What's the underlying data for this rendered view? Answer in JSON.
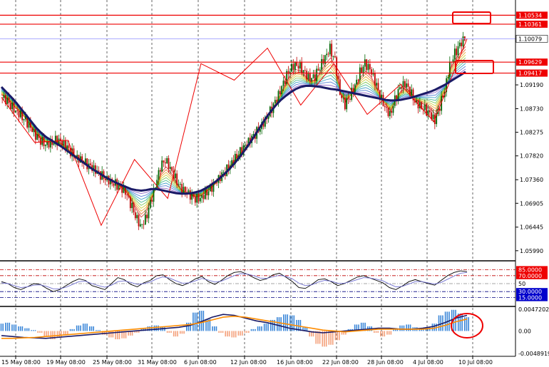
{
  "chart_data": [
    {
      "type": "candlestick",
      "title": "",
      "y_axis_ticks": [
        "1.09190",
        "1.08730",
        "1.08275",
        "1.07820",
        "1.07360",
        "1.06905",
        "1.06445",
        "1.05990"
      ],
      "x_axis_ticks": [
        "15 May 08:00",
        "19 May 08:00",
        "25 May 08:00",
        "31 May 08:00",
        "6 Jun 08:00",
        "12 Jun 08:00",
        "16 Jun 08:00",
        "22 Jun 08:00",
        "28 Jun 08:00",
        "4 Jul 08:00",
        "10 Jul 08:00"
      ],
      "ylim": [
        1.0585,
        1.108
      ],
      "horizontal_levels": [
        {
          "value": 1.10534,
          "label": "1.10534",
          "color": "#ee0000"
        },
        {
          "value": 1.10361,
          "label": "1.10361",
          "color": "#ee0000"
        },
        {
          "value": 1.09629,
          "label": "1.09629",
          "color": "#ee0000"
        },
        {
          "value": 1.09417,
          "label": "1.09417",
          "color": "#ee0000"
        }
      ],
      "current_price": {
        "value": 1.10079,
        "label": "1.10079"
      },
      "price_path": [
        1.0895,
        1.089,
        1.088,
        1.087,
        1.0862,
        1.085,
        1.0835,
        1.082,
        1.0812,
        1.0805,
        1.0808,
        1.0812,
        1.0808,
        1.08,
        1.079,
        1.0782,
        1.0776,
        1.0768,
        1.076,
        1.0752,
        1.0745,
        1.074,
        1.0734,
        1.0728,
        1.072,
        1.071,
        1.069,
        1.0668,
        1.0648,
        1.066,
        1.069,
        1.0722,
        1.076,
        1.0775,
        1.076,
        1.074,
        1.072,
        1.0712,
        1.0705,
        1.07,
        1.0702,
        1.071,
        1.0718,
        1.0728,
        1.074,
        1.0752,
        1.0766,
        1.078,
        1.079,
        1.08,
        1.0812,
        1.0824,
        1.0838,
        1.0852,
        1.0868,
        1.0885,
        1.0905,
        1.093,
        1.095,
        1.096,
        1.0955,
        1.094,
        1.0928,
        1.0935,
        1.0955,
        1.0975,
        1.099,
        1.0965,
        1.09,
        1.088,
        1.0898,
        1.092,
        1.0945,
        1.096,
        1.0948,
        1.0925,
        1.0898,
        1.0878,
        1.0862,
        1.089,
        1.0912,
        1.092,
        1.0908,
        1.0888,
        1.088,
        1.0872,
        1.0862,
        1.0848,
        1.0878,
        1.091,
        1.096,
        1.098,
        1.0995,
        1.1008
      ],
      "ma_path": [
        1.0915,
        1.0905,
        1.0895,
        1.0884,
        1.0872,
        1.086,
        1.0848,
        1.0836,
        1.0826,
        1.0818,
        1.0812,
        1.0806,
        1.08,
        1.0793,
        1.0786,
        1.0779,
        1.0772,
        1.0765,
        1.0758,
        1.0752,
        1.0746,
        1.074,
        1.0735,
        1.073,
        1.0726,
        1.0722,
        1.0718,
        1.0716,
        1.0715,
        1.0716,
        1.0718,
        1.0718,
        1.0716,
        1.0714,
        1.0712,
        1.071,
        1.0709,
        1.0709,
        1.071,
        1.0712,
        1.0715,
        1.072,
        1.0726,
        1.0733,
        1.0741,
        1.075,
        1.076,
        1.0771,
        1.0783,
        1.0796,
        1.081,
        1.0825,
        1.084,
        1.0855,
        1.0868,
        1.088,
        1.089,
        1.0898,
        1.0905,
        1.0911,
        1.0915,
        1.0917,
        1.0917,
        1.0916,
        1.0915,
        1.0913,
        1.0911,
        1.091,
        1.0908,
        1.0906,
        1.0904,
        1.0902,
        1.09,
        1.0898,
        1.0896,
        1.0894,
        1.0892,
        1.089,
        1.0889,
        1.0889,
        1.089,
        1.0892,
        1.0894,
        1.0897,
        1.09,
        1.0903,
        1.0906,
        1.091,
        1.0915,
        1.092,
        1.0926,
        1.0932,
        1.0938,
        1.0944
      ],
      "zigzag": [
        1.0895,
        1.0808,
        1.0812,
        1.0648,
        1.0775,
        1.07,
        1.096,
        1.0928,
        1.099,
        1.088,
        1.096,
        1.0862,
        1.092,
        1.0848,
        1.1008
      ]
    },
    {
      "type": "line",
      "name": "rsi_panel",
      "y_axis_ticks": [
        "85.0000",
        "70.0000",
        "50",
        "30.0000",
        "15.0000"
      ],
      "levels": [
        85,
        70,
        50,
        30,
        15
      ],
      "ylim": [
        0,
        100
      ],
      "series": [
        {
          "values": [
            55,
            50,
            40,
            35,
            42,
            50,
            48,
            38,
            30,
            35,
            45,
            55,
            62,
            58,
            45,
            40,
            35,
            50,
            65,
            60,
            48,
            42,
            52,
            58,
            70,
            72,
            60,
            50,
            45,
            52,
            62,
            68,
            55,
            48,
            58,
            70,
            78,
            80,
            74,
            65,
            58,
            62,
            72,
            76,
            66,
            55,
            40,
            38,
            48,
            60,
            62,
            55,
            45,
            50,
            58,
            66,
            70,
            64,
            58,
            52,
            40,
            35,
            44,
            55,
            60,
            55,
            50,
            46,
            58,
            70,
            78,
            82,
            80
          ]
        },
        {
          "values": [
            52,
            50,
            45,
            40,
            42,
            46,
            47,
            43,
            37,
            37,
            41,
            48,
            55,
            56,
            50,
            45,
            41,
            46,
            55,
            57,
            53,
            48,
            50,
            54,
            62,
            67,
            64,
            57,
            51,
            52,
            57,
            63,
            59,
            54,
            56,
            63,
            70,
            75,
            74,
            70,
            64,
            63,
            67,
            71,
            68,
            62,
            51,
            45,
            47,
            54,
            58,
            56,
            51,
            51,
            55,
            60,
            65,
            64,
            61,
            57,
            49,
            42,
            43,
            49,
            55,
            55,
            52,
            49,
            53,
            61,
            69,
            76,
            78
          ]
        }
      ]
    },
    {
      "type": "bar",
      "name": "macd_panel",
      "y_axis_ticks": [
        "0.0047202",
        "0.00",
        "-0.0048919"
      ],
      "ylim": [
        -0.0048919,
        0.0047202
      ],
      "histogram": [
        0.0016,
        0.0018,
        0.0014,
        0.001,
        0.0006,
        0.0002,
        -0.0004,
        -0.0012,
        -0.0018,
        -0.0015,
        -0.0008,
        0.0004,
        0.0012,
        0.0016,
        0.001,
        0.0002,
        -0.0008,
        -0.0014,
        -0.0018,
        -0.0016,
        -0.001,
        -0.0004,
        0.0006,
        0.001,
        0.0012,
        0.0008,
        -0.0004,
        -0.0012,
        -0.0006,
        0.0018,
        0.004,
        0.0044,
        0.0026,
        0.001,
        -0.0004,
        -0.0012,
        -0.0014,
        -0.001,
        -0.0004,
        0.0004,
        0.001,
        0.0016,
        0.0024,
        0.003,
        0.0036,
        0.0034,
        0.0024,
        0.0008,
        -0.0012,
        -0.0028,
        -0.0034,
        -0.003,
        -0.002,
        -0.0008,
        0.0004,
        0.0014,
        0.0018,
        0.001,
        -0.0004,
        -0.0012,
        -0.0008,
        0.0004,
        0.0012,
        0.0014,
        0.0008,
        0.0004,
        0.0008,
        0.0016,
        0.0034,
        0.0042,
        0.0046,
        0.0038,
        0.003
      ],
      "series": [
        {
          "values": [
            -0.001,
            -0.0012,
            -0.0014,
            -0.0015,
            -0.0016,
            -0.0014,
            -0.0012,
            -0.001,
            -0.0008,
            -0.0006,
            -0.0004,
            -0.0002,
            0.0,
            0.0002,
            0.0004,
            0.0006,
            0.0008,
            0.0012,
            0.002,
            0.003,
            0.0036,
            0.0034,
            0.0028,
            0.0022,
            0.0018,
            0.0012,
            0.0006,
            0.0002,
            -0.0002,
            -0.0004,
            -0.0002,
            0.0,
            0.0002,
            0.0004,
            0.0006,
            0.0006,
            0.0004,
            0.0004,
            0.0006,
            0.001,
            0.0018,
            0.0028,
            0.0034
          ]
        },
        {
          "values": [
            -0.0016,
            -0.0016,
            -0.0015,
            -0.0014,
            -0.0012,
            -0.001,
            -0.0008,
            -0.0006,
            -0.0004,
            -0.0002,
            0.0,
            0.0002,
            0.0004,
            0.0006,
            0.0008,
            0.001,
            0.0012,
            0.0014,
            0.0018,
            0.0024,
            0.003,
            0.0032,
            0.003,
            0.0026,
            0.0022,
            0.0018,
            0.0014,
            0.001,
            0.0006,
            0.0002,
            0.0,
            -0.0002,
            0.0,
            0.0002,
            0.0004,
            0.0004,
            0.0004,
            0.0004,
            0.0004,
            0.0006,
            0.0012,
            0.002,
            0.0026
          ]
        }
      ]
    }
  ],
  "colors": {
    "up_candle": "#006400",
    "down_candle": "#c00000",
    "zigzag": "#ee0000",
    "main_ma": "#1a1a66",
    "rsi_fast": "#000000",
    "rsi_slow": "#7070d0",
    "macd_positive": "#3a86d8",
    "macd_negative": "#f4a07a",
    "macd_signal": "#ff8c00",
    "macd_main": "#1a1a66",
    "annotation": "#ee0000"
  }
}
